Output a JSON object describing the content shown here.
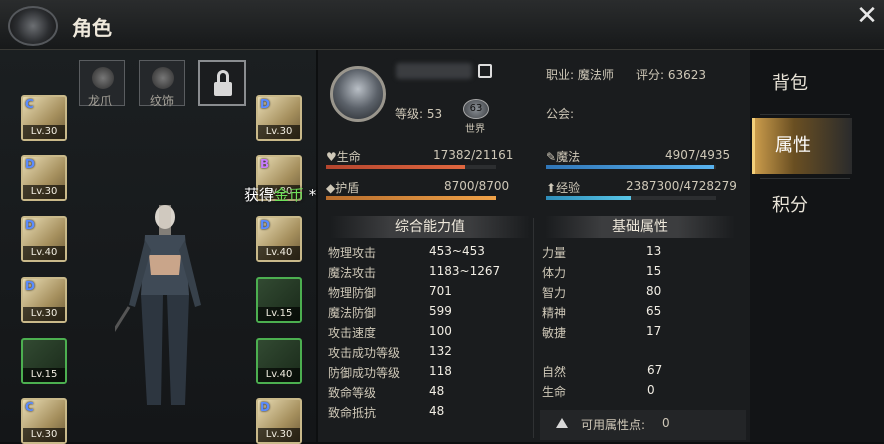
{
  "header": {
    "title": "角色",
    "close_icon": "close-icon"
  },
  "left": {
    "categories": [
      {
        "label": "龙爪",
        "icon": "dragon-claw-icon"
      },
      {
        "label": "纹饰",
        "icon": "ornament-icon"
      }
    ],
    "lock_icon": "lock-icon",
    "left_slots": [
      {
        "grade": "C",
        "level": "Lv.30"
      },
      {
        "grade": "D",
        "level": "Lv.30"
      },
      {
        "grade": "D",
        "level": "Lv.40"
      },
      {
        "grade": "D",
        "level": "Lv.30"
      },
      {
        "grade": "",
        "level": "Lv.15"
      },
      {
        "grade": "C",
        "level": "Lv.30"
      }
    ],
    "right_slots": [
      {
        "grade": "D",
        "level": "Lv.30"
      },
      {
        "grade": "B",
        "level": "Lv.30"
      },
      {
        "grade": "D",
        "level": "Lv.40"
      },
      {
        "grade": "",
        "level": "Lv.15"
      },
      {
        "grade": "",
        "level": "Lv.40"
      },
      {
        "grade": "D",
        "level": "Lv.30"
      }
    ],
    "gold_message": {
      "prefix": "获得",
      "item": "金币",
      "suffix": " * 50"
    }
  },
  "profile": {
    "job_label": "职业: 魔法师",
    "score_label": "评分: 63623",
    "level_label": "等级: 53",
    "world_badge_num": "63",
    "world_label": "世界",
    "guild_label": "公会:",
    "bars": {
      "hp": {
        "label": "生命",
        "value": "17382/21161",
        "fill": 0.82
      },
      "mp": {
        "label": "魔法",
        "value": "4907/4935",
        "fill": 0.99
      },
      "shield": {
        "label": "护盾",
        "value": "8700/8700",
        "fill": 1.0
      },
      "exp": {
        "label": "经验",
        "value": "2387300/4728279",
        "fill": 0.5
      }
    }
  },
  "combat": {
    "title": "综合能力值",
    "rows": [
      {
        "k": "物理攻击",
        "v": "453~453"
      },
      {
        "k": "魔法攻击",
        "v": "1183~1267"
      },
      {
        "k": "物理防御",
        "v": "701"
      },
      {
        "k": "魔法防御",
        "v": "599"
      },
      {
        "k": "攻击速度",
        "v": "100"
      },
      {
        "k": "攻击成功等级",
        "v": "132"
      },
      {
        "k": "防御成功等级",
        "v": "118"
      },
      {
        "k": "致命等级",
        "v": "48"
      },
      {
        "k": "致命抵抗",
        "v": "48"
      }
    ]
  },
  "base": {
    "title": "基础属性",
    "rows": [
      {
        "k": "力量",
        "v": "13"
      },
      {
        "k": "体力",
        "v": "15"
      },
      {
        "k": "智力",
        "v": "80"
      },
      {
        "k": "精神",
        "v": "65"
      },
      {
        "k": "敏捷",
        "v": "17"
      }
    ],
    "extra": [
      {
        "k": "自然",
        "v": "67"
      },
      {
        "k": "生命",
        "v": "0"
      }
    ],
    "available_label": "可用属性点:",
    "available_value": "0"
  },
  "tabs": [
    {
      "label": "背包",
      "active": false
    },
    {
      "label": "属性",
      "active": true
    },
    {
      "label": "积分",
      "active": false
    }
  ],
  "colors": {
    "gold_text": "#6fe05a",
    "hp": "#e0673f",
    "mp": "#59b3ef",
    "active_tab": "#c99b4b"
  }
}
